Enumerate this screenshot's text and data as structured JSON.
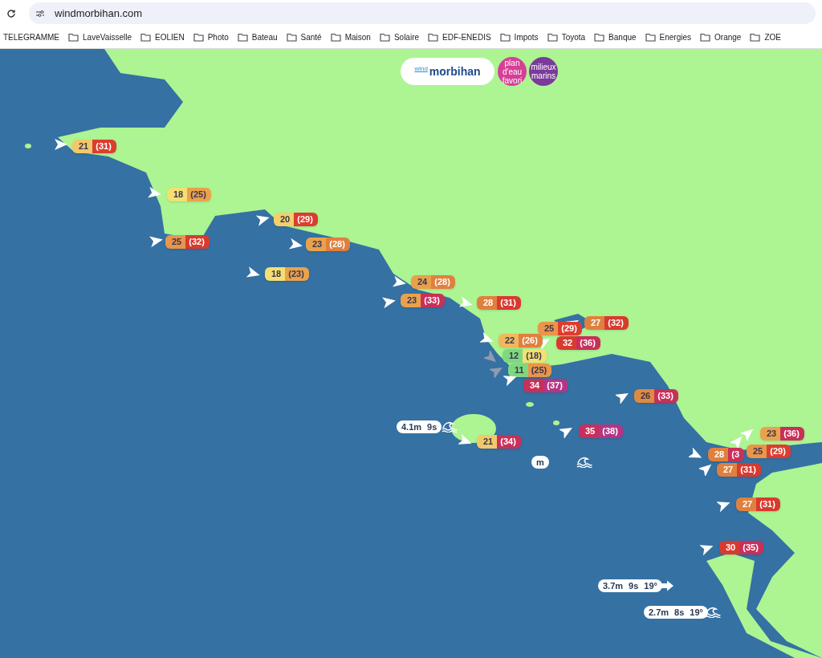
{
  "browser": {
    "url": "windmorbihan.com",
    "bookmarks": [
      {
        "label": "TELEGRAMME",
        "kind": "link"
      },
      {
        "label": "LaveVaisselle",
        "kind": "folder"
      },
      {
        "label": "EOLIEN",
        "kind": "folder"
      },
      {
        "label": "Photo",
        "kind": "folder"
      },
      {
        "label": "Bateau",
        "kind": "folder"
      },
      {
        "label": "Santé",
        "kind": "folder"
      },
      {
        "label": "Maison",
        "kind": "folder"
      },
      {
        "label": "Solaire",
        "kind": "folder"
      },
      {
        "label": "EDF-ENEDIS",
        "kind": "folder"
      },
      {
        "label": "Impots",
        "kind": "folder"
      },
      {
        "label": "Toyota",
        "kind": "folder"
      },
      {
        "label": "Banque",
        "kind": "folder"
      },
      {
        "label": "Energies",
        "kind": "folder"
      },
      {
        "label": "Orange",
        "kind": "folder"
      },
      {
        "label": "ZOE",
        "kind": "folder"
      }
    ]
  },
  "header": {
    "logo": {
      "word_1": "wind",
      "word_2": "morbihan"
    },
    "buttons": [
      {
        "label": "plan d'eau favori",
        "color": "#d63f96"
      },
      {
        "label": "milieux marins",
        "color": "#7b3a9a"
      }
    ]
  },
  "map": {
    "stations": [
      {
        "speed": {
          "text": "21",
          "color": "#f2c96a"
        },
        "gust": {
          "text": "(31)",
          "color": "#dc3d2e"
        },
        "arrow_muted": false
      },
      {
        "speed": {
          "text": "18",
          "color": "#f3e070"
        },
        "gust": {
          "text": "(25)",
          "color": "#e9a24c"
        },
        "arrow_muted": false
      },
      {
        "speed": {
          "text": "25",
          "color": "#e9954a"
        },
        "gust": {
          "text": "(32)",
          "color": "#d93a2e"
        },
        "arrow_muted": false
      },
      {
        "speed": {
          "text": "20",
          "color": "#f2d06a"
        },
        "gust": {
          "text": "(29)",
          "color": "#dc3d2e"
        },
        "arrow_muted": false
      },
      {
        "speed": {
          "text": "23",
          "color": "#e9a24c"
        },
        "gust": {
          "text": "(28)",
          "color": "#e0803e"
        },
        "arrow_muted": false
      },
      {
        "speed": {
          "text": "18",
          "color": "#f3e070"
        },
        "gust": {
          "text": "(23)",
          "color": "#e9a24c"
        },
        "arrow_muted": false
      },
      {
        "speed": {
          "text": "24",
          "color": "#e9a04a"
        },
        "gust": {
          "text": "(28)",
          "color": "#e0803e"
        },
        "arrow_muted": false
      },
      {
        "speed": {
          "text": "23",
          "color": "#e9a24c"
        },
        "gust": {
          "text": "(33)",
          "color": "#c8305a"
        },
        "arrow_muted": false
      },
      {
        "speed": {
          "text": "28",
          "color": "#e0803e"
        },
        "gust": {
          "text": "(31)",
          "color": "#d93a2e"
        },
        "arrow_muted": false
      },
      {
        "speed": {
          "text": "27",
          "color": "#e0803e"
        },
        "gust": {
          "text": "(32)",
          "color": "#d93a2e"
        },
        "arrow_muted": false
      },
      {
        "speed": {
          "text": "25",
          "color": "#e9954a"
        },
        "gust": {
          "text": "(29)",
          "color": "#dc3d2e"
        }
      },
      {
        "speed": {
          "text": "32",
          "color": "#d93a2e"
        },
        "gust": {
          "text": "(36)",
          "color": "#c8305a"
        },
        "arrow_muted": false
      },
      {
        "speed": {
          "text": "22",
          "color": "#efb85a"
        },
        "gust": {
          "text": "(26)",
          "color": "#e0803e"
        },
        "arrow_muted": false
      },
      {
        "speed": {
          "text": "12",
          "color": "#7ed880"
        },
        "gust": {
          "text": "(18)",
          "color": "#f3e070"
        },
        "arrow_muted": true
      },
      {
        "speed": {
          "text": "11",
          "color": "#7ed880"
        },
        "gust": {
          "text": "(25)",
          "color": "#e9954a"
        },
        "arrow_muted": true
      },
      {
        "speed": {
          "text": "34",
          "color": "#c8305a"
        },
        "gust": {
          "text": "(37)",
          "color": "#b53585"
        },
        "arrow_muted": false
      },
      {
        "speed": {
          "text": "26",
          "color": "#e08a40"
        },
        "gust": {
          "text": "(33)",
          "color": "#c8305a"
        },
        "arrow_muted": false
      },
      {
        "speed": {
          "text": "35",
          "color": "#c8305a"
        },
        "gust": {
          "text": "(38)",
          "color": "#b53585"
        },
        "arrow_muted": false
      },
      {
        "speed": {
          "text": "21",
          "color": "#f2c96a"
        },
        "gust": {
          "text": "(34)",
          "color": "#c8305a"
        },
        "arrow_muted": false
      },
      {
        "speed": {
          "text": "23",
          "color": "#e9a24c"
        },
        "gust": {
          "text": "(36)",
          "color": "#c8305a"
        },
        "arrow_muted": false
      },
      {
        "speed": {
          "text": "25",
          "color": "#e9954a"
        },
        "gust": {
          "text": "(29)",
          "color": "#dc3d2e"
        },
        "arrow_muted": false
      },
      {
        "speed": {
          "text": "28",
          "color": "#e0803e"
        },
        "gust": {
          "text": "(3",
          "color": "#c8305a"
        },
        "arrow_muted": false
      },
      {
        "speed": {
          "text": "27",
          "color": "#e0803e"
        },
        "gust": {
          "text": "(31)",
          "color": "#d93a2e"
        },
        "arrow_muted": false
      },
      {
        "speed": {
          "text": "27",
          "color": "#e0803e"
        },
        "gust": {
          "text": "(31)",
          "color": "#d93a2e"
        },
        "arrow_muted": false
      },
      {
        "speed": {
          "text": "30",
          "color": "#d93a2e"
        },
        "gust": {
          "text": "(35)",
          "color": "#c8305a"
        },
        "arrow_muted": false
      }
    ],
    "swells": [
      {
        "kind": "wave",
        "height": "4.1m",
        "period": "9s"
      },
      {
        "kind": "arrow",
        "height": "3.7m",
        "period": "9s",
        "direction": "19°"
      },
      {
        "kind": "wave",
        "height": "2.7m",
        "period": "8s",
        "direction": "19°"
      },
      {
        "kind": "wave",
        "height": "m"
      }
    ]
  }
}
